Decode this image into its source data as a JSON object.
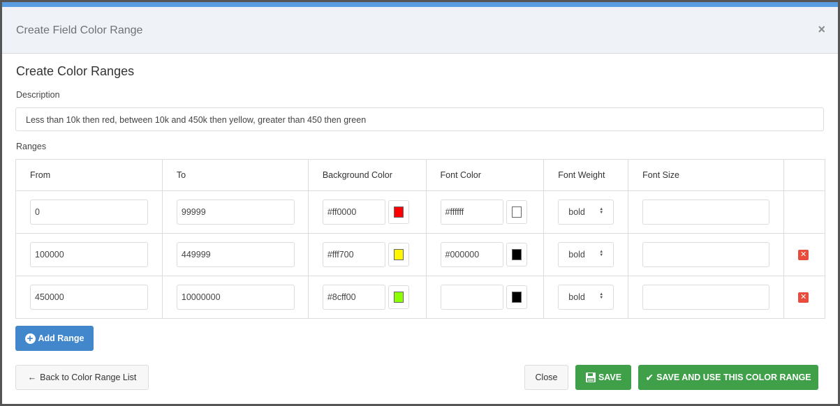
{
  "modal": {
    "title": "Create Field Color Range",
    "close_icon": "×"
  },
  "section_title": "Create Color Ranges",
  "description": {
    "label": "Description",
    "value": "Less than 10k then red, between 10k and 450k then yellow, greater than 450 then green"
  },
  "ranges": {
    "label": "Ranges",
    "columns": [
      "From",
      "To",
      "Background Color",
      "Font Color",
      "Font Weight",
      "Font Size",
      ""
    ],
    "rows": [
      {
        "from": "0",
        "to": "99999",
        "bg_color": "#ff0000",
        "bg_swatch": "#ff0000",
        "font_color": "#ffffff",
        "font_swatch": "#ffffff",
        "font_weight": "bold",
        "font_size": "",
        "deletable": false
      },
      {
        "from": "100000",
        "to": "449999",
        "bg_color": "#fff700",
        "bg_swatch": "#fff700",
        "font_color": "#000000",
        "font_swatch": "#000000",
        "font_weight": "bold",
        "font_size": "",
        "deletable": true
      },
      {
        "from": "450000",
        "to": "10000000",
        "bg_color": "#8cff00",
        "bg_swatch": "#8cff00",
        "font_color": "",
        "font_swatch": "#000000",
        "font_weight": "bold",
        "font_size": "",
        "deletable": true
      }
    ],
    "delete_icon": "✕",
    "select_arrows": "▲▼"
  },
  "buttons": {
    "add_range": "Add Range",
    "back": "Back to Color Range List",
    "back_icon": "←",
    "close": "Close",
    "save": "SAVE",
    "save_icon": "floppy-disk",
    "save_and_use": "SAVE AND USE THIS COLOR RANGE",
    "save_and_use_icon": "✔"
  },
  "colors": {
    "accent_blue": "#4286cc",
    "header_bar": "#5a9de0",
    "success_green": "#40a04a",
    "danger_red": "#e74c3c"
  }
}
